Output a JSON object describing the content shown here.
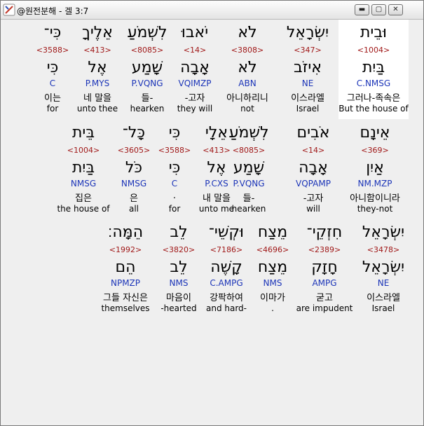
{
  "window": {
    "title": "@원전분해 - 겔 3:7"
  },
  "rows": [
    [
      {
        "heb": "וּבֵית",
        "strong": "<1004>",
        "lex": "בַּיִת",
        "morph": "C.NMSG",
        "kor": "그러나-족속은",
        "eng": "But the house of",
        "highlight": true
      },
      {
        "heb": "יִשְׂרָאֵל",
        "strong": "<347>",
        "lex": "אִיזֹב",
        "morph": "NE",
        "kor": "이스라엘",
        "eng": "Israel"
      },
      {
        "heb": "לֹא",
        "strong": "<3808>",
        "lex": "לֹא",
        "morph": "ABN",
        "kor": "아니하리니",
        "eng": "not"
      },
      {
        "heb": "יֹאבוּ",
        "strong": "<14>",
        "lex": "אָבָה",
        "morph": "VQIMZP",
        "kor": "-고자",
        "eng": "they will"
      },
      {
        "heb": "לִשְׁמֹעַ",
        "strong": "<8085>",
        "lex": "שָׁמַע",
        "morph": "P.VQNG",
        "kor": "들-",
        "eng": "hearken"
      },
      {
        "heb": "אֵלֶיךָ",
        "strong": "<413>",
        "lex": "אֶל",
        "morph": "P.MYS",
        "kor": "네 말을",
        "eng": "unto thee"
      },
      {
        "heb": "כִּי־",
        "strong": "<3588>",
        "lex": "כִּי",
        "morph": "C",
        "kor": "이는",
        "eng": "for"
      }
    ],
    [
      {
        "heb": "אֵינָם",
        "strong": "<369>",
        "lex": "אַיִן",
        "morph": "NM.MZP",
        "kor": "아니함이니라",
        "eng": "they-not"
      },
      {
        "heb": "אֹבִים",
        "strong": "<14>",
        "lex": "אָבָה",
        "morph": "VQPAMP",
        "kor": "-고자",
        "eng": "will"
      },
      {
        "heb": "לִשְׁמֹעַ",
        "strong": "<8085>",
        "lex": "שָׁמַע",
        "morph": "P.VQNG",
        "kor": "들-",
        "eng": "hearken"
      },
      {
        "heb": "אֵלָי",
        "strong": "<413>",
        "lex": "אֶל",
        "morph": "P.CXS",
        "kor": "내 말을",
        "eng": "unto me"
      },
      {
        "heb": "כִּי",
        "strong": "<3588>",
        "lex": "כִּי",
        "morph": "C",
        "kor": ".",
        "eng": "for"
      },
      {
        "heb": "כָּל־",
        "strong": "<3605>",
        "lex": "כֹּל",
        "morph": "NMSG",
        "kor": "은",
        "eng": "all"
      },
      {
        "heb": "בֵּית",
        "strong": "<1004>",
        "lex": "בַּיִת",
        "morph": "NMSG",
        "kor": "집은",
        "eng": "the house of"
      }
    ],
    [
      {
        "heb": "יִשְׂרָאֵל",
        "strong": "<3478>",
        "lex": "יִשְׂרָאֵל",
        "morph": "NE",
        "kor": "이스라엘",
        "eng": "Israel"
      },
      {
        "heb": "חִזְקֵי־",
        "strong": "<2389>",
        "lex": "חָזָק",
        "morph": "AMPG",
        "kor": "굳고",
        "eng": "are impudent"
      },
      {
        "heb": "מֵצַח",
        "strong": "<4696>",
        "lex": "מֵצַח",
        "morph": "NMS",
        "kor": "이마가",
        "eng": "."
      },
      {
        "heb": "וּקְשֵׁי־",
        "strong": "<7186>",
        "lex": "קָשֶׁה",
        "morph": "C.AMPG",
        "kor": "강팍하여",
        "eng": "and hard-"
      },
      {
        "heb": "לֵב",
        "strong": "<3820>",
        "lex": "לֵב",
        "morph": "NMS",
        "kor": "마음이",
        "eng": "-hearted"
      },
      {
        "heb": "הֵמָּה׃",
        "strong": "<1992>",
        "lex": "הֵם",
        "morph": "NPMZP",
        "kor": "그들 자신은",
        "eng": "themselves"
      }
    ]
  ]
}
